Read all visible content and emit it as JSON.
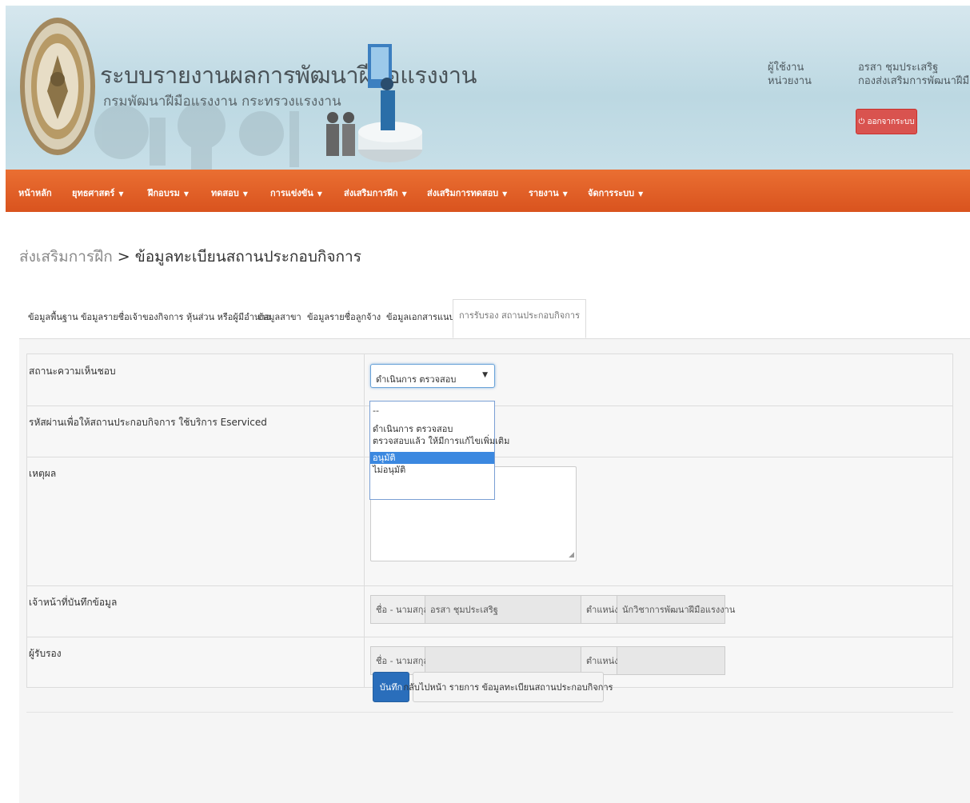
{
  "header": {
    "title": "ระบบรายงานผลการพัฒนาฝีมือแรงงาน",
    "subtitle": "กรมพัฒนาฝีมือแรงงาน กระทรวงแรงงาน",
    "user_label": "ผู้ใช้งาน",
    "unit_label": "หน่วยงาน",
    "user_name": "อรสา ชุมประเสริฐ",
    "unit_name": "กองส่งเสริมการพัฒนาฝีมือแรงงาน",
    "logout_label": "ออกจากระบบ"
  },
  "nav": {
    "items": [
      {
        "label": "หน้าหลัก",
        "dropdown": false
      },
      {
        "label": "ยุทธศาสตร์",
        "dropdown": true
      },
      {
        "label": "ฝึกอบรม",
        "dropdown": true
      },
      {
        "label": "ทดสอบ",
        "dropdown": true
      },
      {
        "label": "การแข่งขัน",
        "dropdown": true
      },
      {
        "label": "ส่งเสริมการฝึก",
        "dropdown": true
      },
      {
        "label": "ส่งเสริมการทดสอบ",
        "dropdown": true
      },
      {
        "label": "รายงาน",
        "dropdown": true
      },
      {
        "label": "จัดการระบบ",
        "dropdown": true
      }
    ]
  },
  "breadcrumb": {
    "parent": "ส่งเสริมการฝึก",
    "separator": " > ",
    "current": "ข้อมูลทะเบียนสถานประกอบกิจการ"
  },
  "tabs": [
    {
      "label": "ข้อมูลพื้นฐาน",
      "active": false
    },
    {
      "label": "ข้อมูลรายชื่อเจ้าของกิจการ หุ้นส่วน หรือผู้มีอำนาจ",
      "active": false
    },
    {
      "label": "ข้อมูลสาขา",
      "active": false
    },
    {
      "label": "ข้อมูลรายชื่อลูกจ้าง",
      "active": false
    },
    {
      "label": "ข้อมูลเอกสารแนบ",
      "active": false
    },
    {
      "label": "การรับรอง สถานประกอบกิจการ",
      "active": true
    }
  ],
  "form": {
    "status_label": "สถานะความเห็นชอบ",
    "status_value": "ดำเนินการ ตรวจสอบ",
    "status_options": [
      "--",
      "ดำเนินการ ตรวจสอบ",
      "ตรวจสอบแล้ว ให้มีการแก้ไขเพิ่มเติม",
      "อนุมัติ",
      "ไม่อนุมัติ"
    ],
    "status_highlighted": "อนุมัติ",
    "password_label": "รหัสผ่านเพื่อให้สถานประกอบกิจการ ใช้บริการ Eserviced",
    "reason_label": "เหตุผล",
    "reason_value": "",
    "recorder_label": "เจ้าหน้าที่บันทึกข้อมูล",
    "recorder_name_label": "ชื่อ - นามสกุล",
    "recorder_name_value": "อรสา ชุมประเสริฐ",
    "recorder_position_label": "ตำแหน่ง",
    "recorder_position_value": "นักวิชาการพัฒนาฝีมือแรงงาน",
    "certifier_label": "ผู้รับรอง",
    "certifier_name_label": "ชื่อ - นามสกุล",
    "certifier_name_value": "",
    "certifier_position_label": "ตำแหน่ง",
    "certifier_position_value": ""
  },
  "actions": {
    "save_label": "บันทึก",
    "back_label": "กลับไปหน้า รายการ ข้อมูลทะเบียนสถานประกอบกิจการ"
  },
  "colors": {
    "nav_bg": "#e0612a",
    "primary_button": "#2a6ebb",
    "logout_button": "#d9534f",
    "dropdown_highlight": "#3b88e0"
  },
  "icons": {
    "logo": "department-seal-icon",
    "banner_graphic": "presenter-illustration-icon",
    "logout": "power-icon",
    "select_arrow": "caret-down-icon"
  }
}
